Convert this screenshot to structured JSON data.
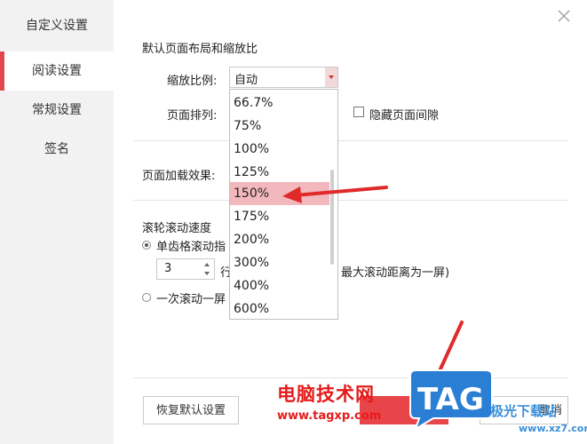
{
  "sidebar": {
    "title": "自定义设置",
    "items": [
      {
        "label": "阅读设置"
      },
      {
        "label": "常规设置"
      },
      {
        "label": "签名"
      }
    ]
  },
  "main": {
    "section_layout_title": "默认页面布局和缩放比",
    "zoom_label": "缩放比例:",
    "zoom_value": "自动",
    "arrange_label": "页面排列:",
    "hide_gap_label": "隐藏页面间隙",
    "load_effect_label": "页面加载效果:",
    "scroll_section_title": "滚轮滚动速度",
    "scroll_option1": "单齿格滚动指",
    "lines_value": "3",
    "lines_unit": "行",
    "max_scroll_text": "最大滚动距离为一屏)",
    "scroll_option2": "一次滚动一屏",
    "restore_button": "恢复默认设置",
    "cancel_button": "取消"
  },
  "dropdown": {
    "options": [
      "66.7%",
      "75%",
      "100%",
      "125%",
      "150%",
      "175%",
      "200%",
      "300%",
      "400%",
      "600%"
    ],
    "selected_index": 4
  },
  "watermark": {
    "site_cn": "电脑技术网",
    "site_url": "www.tagxp.com",
    "tag": "TAG",
    "site2_cn": "极光下载站",
    "site2_url": "www.xz7.com"
  },
  "colors": {
    "accent": "#e0474c",
    "selected_option": "#f2b8bd",
    "arrow": "#e02a2a",
    "tag_blue": "#2a7fd4"
  }
}
